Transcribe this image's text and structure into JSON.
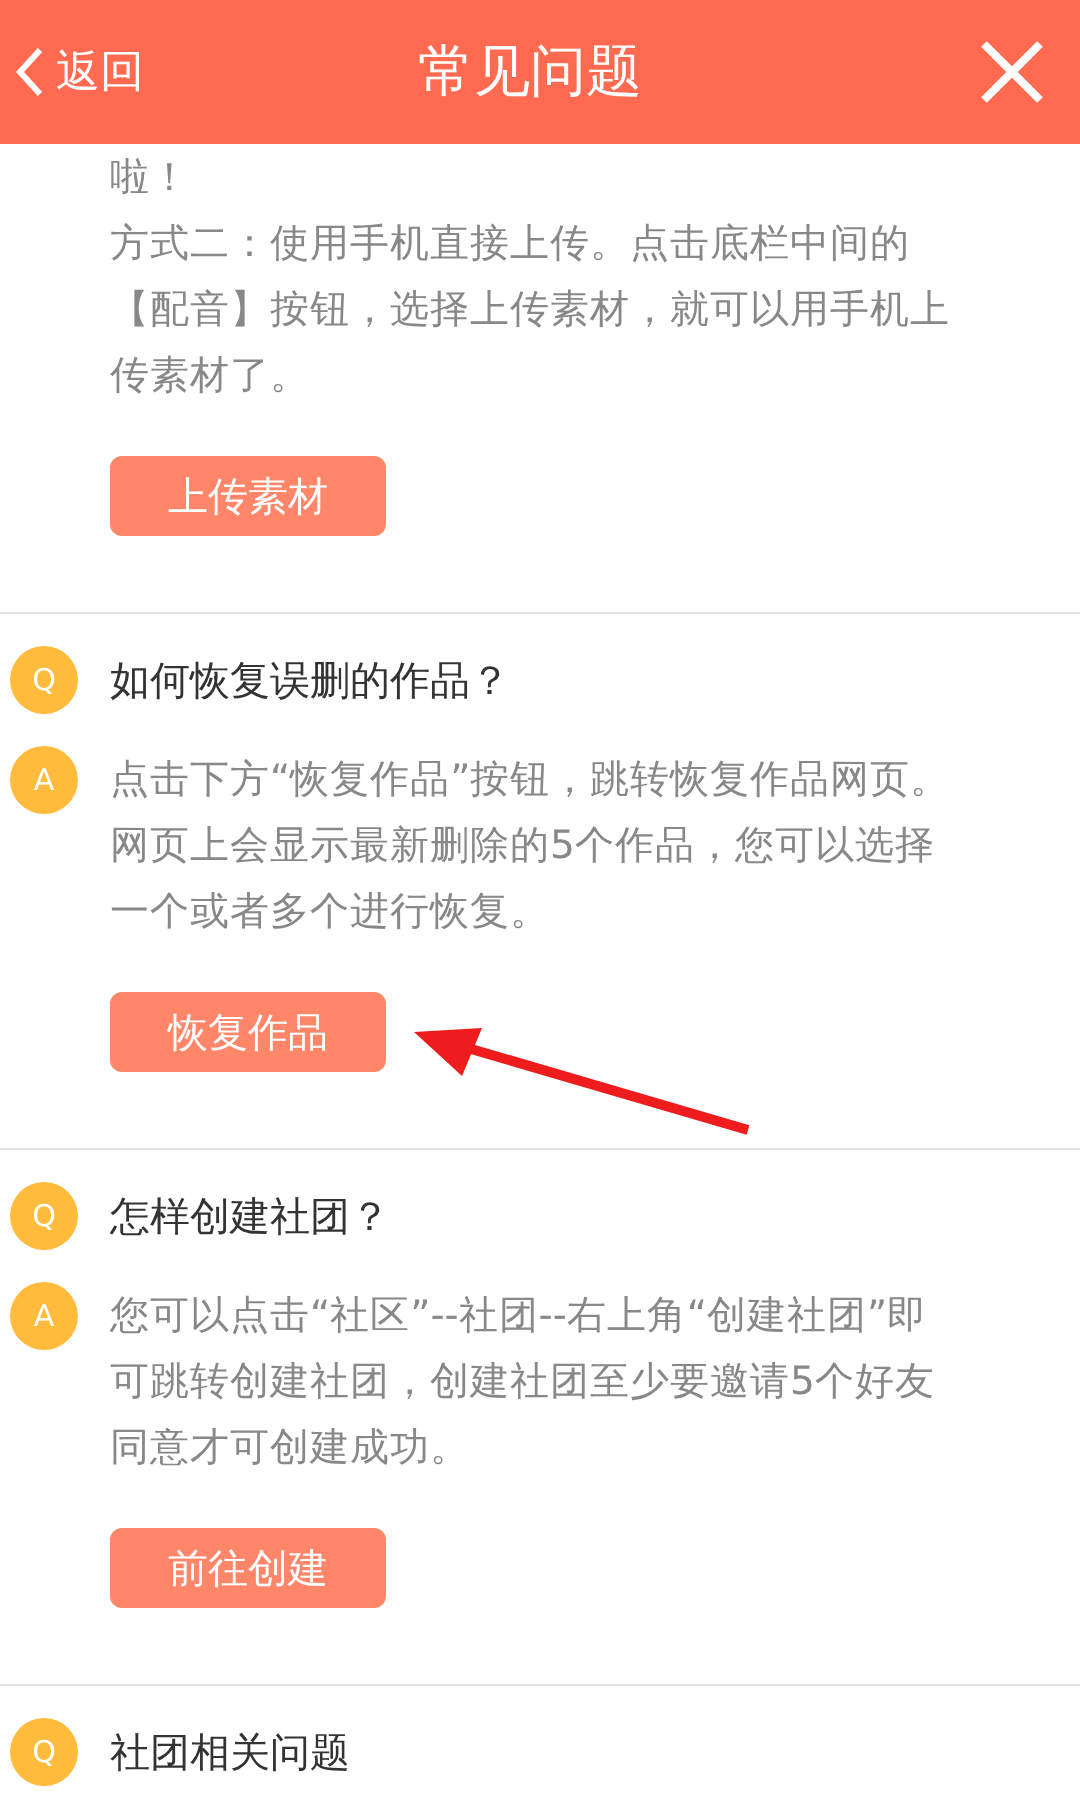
{
  "header": {
    "back": "返回",
    "title": "常见问题"
  },
  "sections": [
    {
      "answer": [
        "啦！",
        "方式二：使用手机直接上传。点击底栏中间的【配音】按钮，选择上传素材，就可以用手机上传素材了。"
      ],
      "button": "上传素材"
    },
    {
      "q_badge": "Q",
      "question": "如何恢复误删的作品？",
      "a_badge": "A",
      "answer": [
        "点击下方“恢复作品”按钮，跳转恢复作品网页。网页上会显示最新删除的5个作品，您可以选择一个或者多个进行恢复。"
      ],
      "button": "恢复作品",
      "annotation": {
        "kind": "arrow"
      }
    },
    {
      "q_badge": "Q",
      "question": "怎样创建社团？",
      "a_badge": "A",
      "answer": [
        "您可以点击“社区”--社团--右上角“创建社团”即可跳转创建社团，创建社团至少要邀请5个好友同意才可创建成功。"
      ],
      "button": "前往创建"
    },
    {
      "q_badge": "Q",
      "question": "社团相关问题"
    }
  ]
}
